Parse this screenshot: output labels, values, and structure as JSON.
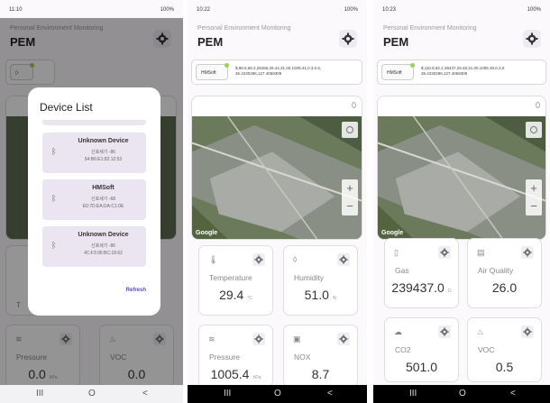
{
  "phone1": {
    "time": "11:10",
    "status_right": "100%",
    "subtitle": "Personal Environment Monitoring",
    "title": "PEM",
    "dialog": {
      "title": "Device List",
      "items": [
        {
          "name": "Unknown Device",
          "rssi": "신호세기 -86",
          "mac": "54:B6:E1:82:12:53"
        },
        {
          "name": "HMSoft",
          "rssi": "신호세기 -68",
          "mac": "E0:7D:EA:DA:C1:0E"
        },
        {
          "name": "Unknown Device",
          "rssi": "신호세기 -86",
          "mac": "4C:F3:95:BC:18:62"
        }
      ],
      "refresh": "Refresh"
    },
    "bg_cards": [
      {
        "label": "Pressure",
        "value": "0.0",
        "unit": "hPa"
      },
      {
        "label": "VOC",
        "value": "0.0",
        "unit": ""
      }
    ],
    "bg_te_label": "T"
  },
  "phone2": {
    "time": "10:22",
    "status_right": "100%",
    "subtitle": "Personal Environment Monitoring",
    "title": "PEM",
    "device_chip": "HMSoft",
    "device_data_1": "$,98.8,68.2,28456,29.44,31.00,1005.41,0.3,0.6,",
    "device_data_2": "36.4230286,127.4069309",
    "map_label": "Google",
    "cards": [
      {
        "label": "Temperature",
        "value": "29.4",
        "unit": "°C",
        "icon": "thermometer-icon"
      },
      {
        "label": "Humidity",
        "value": "51.0",
        "unit": "%",
        "icon": "droplet-icon"
      },
      {
        "label": "Pressure",
        "value": "1005.4",
        "unit": "hPa",
        "icon": "wind-icon"
      },
      {
        "label": "NOX",
        "value": "8.7",
        "unit": "",
        "icon": "nox-icon"
      }
    ]
  },
  "phone3": {
    "time": "10:23",
    "status_right": "100%",
    "subtitle": "Personal Environment Monitoring",
    "title": "PEM",
    "device_chip": "HMSoft",
    "device_data_1": "$,110.8,62.2,39437,29.48,31.00,1005.30,0.3,0.",
    "device_data_2": "36.4230286,127.4069309",
    "map_label": "Google",
    "cards": [
      {
        "label": "Gas",
        "value": "239437.0",
        "unit": "Ω",
        "icon": "gas-icon"
      },
      {
        "label": "Air Quality",
        "value": "26.0",
        "unit": "",
        "icon": "iaq-icon"
      },
      {
        "label": "CO2",
        "value": "501.0",
        "unit": "",
        "icon": "co2-icon"
      },
      {
        "label": "VOC",
        "value": "0.5",
        "unit": "",
        "icon": "voc-icon"
      }
    ]
  },
  "nav": {
    "recent": "III",
    "home": "O",
    "back": "<"
  },
  "colors": {
    "accent": "#5a4bb0",
    "item_bg": "#ebe5f1",
    "chip_dot": "#9ad34c"
  }
}
